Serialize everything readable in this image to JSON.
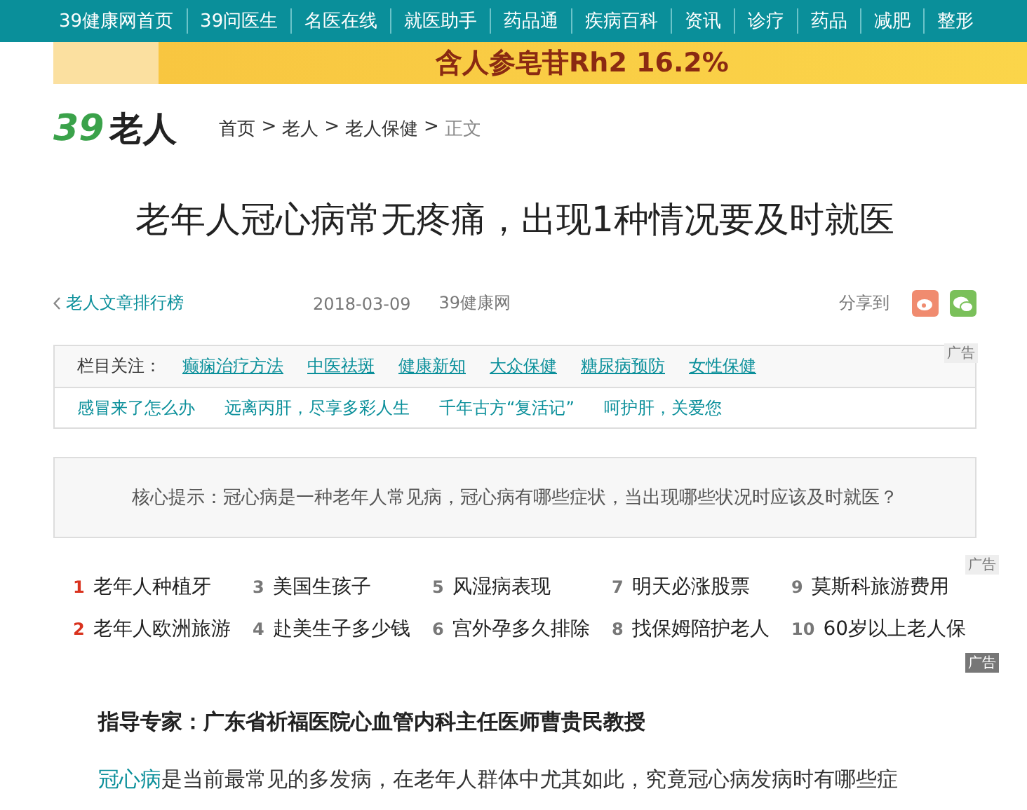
{
  "top_nav": {
    "items": [
      "39健康网首页",
      "39问医生",
      "名医在线",
      "就医助手",
      "药品通",
      "疾病百科",
      "资讯",
      "诊疗",
      "药品",
      "减肥",
      "整形"
    ]
  },
  "banner": {
    "text": "含人参皂苷Rh2 16.2%"
  },
  "logo": {
    "number": "39",
    "text": "老人"
  },
  "breadcrumb": {
    "separator": ">",
    "items": [
      "首页",
      "老人",
      "老人保健",
      "正文"
    ]
  },
  "article": {
    "title": "老年人冠心病常无疼痛，出现1种情况要及时就医",
    "back_link": "老人文章排行榜",
    "date": "2018-03-09",
    "source": "39健康网",
    "share_label": "分享到"
  },
  "column_box": {
    "label": "栏目关注：",
    "links": [
      "癫痫治疗方法",
      "中医祛斑",
      "健康新知",
      "大众保健",
      "糖尿病预防",
      "女性保健"
    ],
    "ad_label": "广告",
    "promos": [
      "感冒来了怎么办",
      "远离丙肝，尽享多彩人生",
      "千年古方“复活记”",
      "呵护肝，关爱您"
    ]
  },
  "tip": {
    "text": "核心提示：冠心病是一种老年人常见病，冠心病有哪些症状，当出现哪些状况时应该及时就医？"
  },
  "hot_list": {
    "ad_labels": [
      "广告",
      "广告"
    ],
    "items": [
      {
        "rank": "1",
        "text": "老年人种植牙",
        "top": true
      },
      {
        "rank": "2",
        "text": "老年人欧洲旅游",
        "top": true
      },
      {
        "rank": "3",
        "text": "美国生孩子",
        "top": false
      },
      {
        "rank": "4",
        "text": "赴美生子多少钱",
        "top": false
      },
      {
        "rank": "5",
        "text": "风湿病表现",
        "top": false
      },
      {
        "rank": "6",
        "text": "宫外孕多久排除",
        "top": false
      },
      {
        "rank": "7",
        "text": "明天必涨股票",
        "top": false
      },
      {
        "rank": "8",
        "text": "找保姆陪护老人",
        "top": false
      },
      {
        "rank": "9",
        "text": "莫斯科旅游费用",
        "top": false
      },
      {
        "rank": "10",
        "text": "60岁以上老人保",
        "top": false
      }
    ]
  },
  "expert": {
    "text": "指导专家：广东省祈福医院心血管内科主任医师曹贵民教授"
  },
  "body": {
    "link": "冠心病",
    "text": "是当前最常见的多发病，在老年人群体中尤其如此，究竟冠心病发病时有哪些症"
  }
}
